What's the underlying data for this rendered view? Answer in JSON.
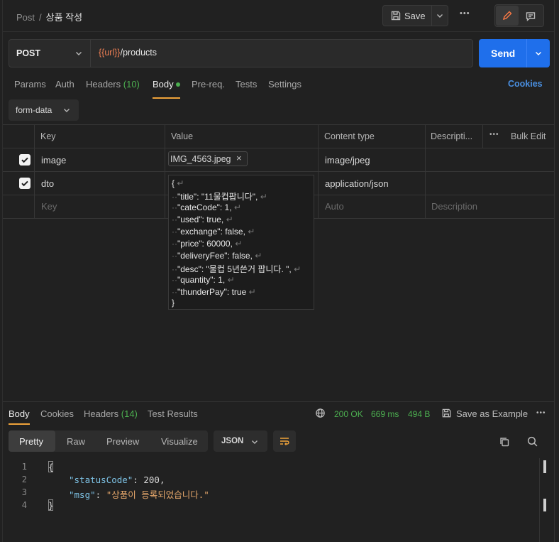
{
  "breadcrumb": {
    "parent": "Post",
    "separator": "/",
    "current": "상품 작성"
  },
  "toolbar": {
    "save_label": "Save",
    "more": "•••"
  },
  "request": {
    "method": "POST",
    "url_var": "{{url}}",
    "url_path": "/products",
    "send_label": "Send"
  },
  "tabs": {
    "params": "Params",
    "auth": "Auth",
    "headers": "Headers",
    "headers_count": "(10)",
    "body": "Body",
    "prereq": "Pre-req.",
    "tests": "Tests",
    "settings": "Settings",
    "cookies": "Cookies"
  },
  "body_type": "form-data",
  "table": {
    "headers": {
      "key": "Key",
      "value": "Value",
      "content_type": "Content type",
      "description": "Descripti...",
      "bulk_edit": "Bulk Edit"
    },
    "rows": [
      {
        "key": "image",
        "value": "IMG_4563.jpeg",
        "content_type": "image/jpeg",
        "checked": true
      },
      {
        "key": "dto",
        "value": "",
        "content_type": "application/json",
        "checked": true
      }
    ],
    "placeholders": {
      "key": "Key",
      "value": "Value",
      "content_type": "Auto",
      "description": "Description"
    }
  },
  "dto_json_lines": [
    "{",
    "\"title\": \"11물컵팝니다\",",
    "\"cateCode\": 1,",
    "\"used\": true,",
    "\"exchange\": false,",
    "\"price\": 60000,",
    "\"deliveryFee\": false,",
    "\"desc\": \"물컵 5년쓴거 팝니다. \",",
    "\"quantity\": 1,",
    "\"thunderPay\": true",
    "}"
  ],
  "response": {
    "tabs": {
      "body": "Body",
      "cookies": "Cookies",
      "headers": "Headers",
      "headers_count": "(14)",
      "test_results": "Test Results"
    },
    "status": "200 OK",
    "time": "669 ms",
    "size": "494 B",
    "save_example": "Save as Example",
    "views": {
      "pretty": "Pretty",
      "raw": "Raw",
      "preview": "Preview",
      "visualize": "Visualize"
    },
    "format": "JSON",
    "code": {
      "line_numbers": [
        "1",
        "2",
        "3",
        "4"
      ],
      "open": "{",
      "key1": "\"statusCode\"",
      "val1": "200",
      "key2": "\"msg\"",
      "val2": "\"상품이 등록되었습니다.\"",
      "close": "}"
    }
  }
}
